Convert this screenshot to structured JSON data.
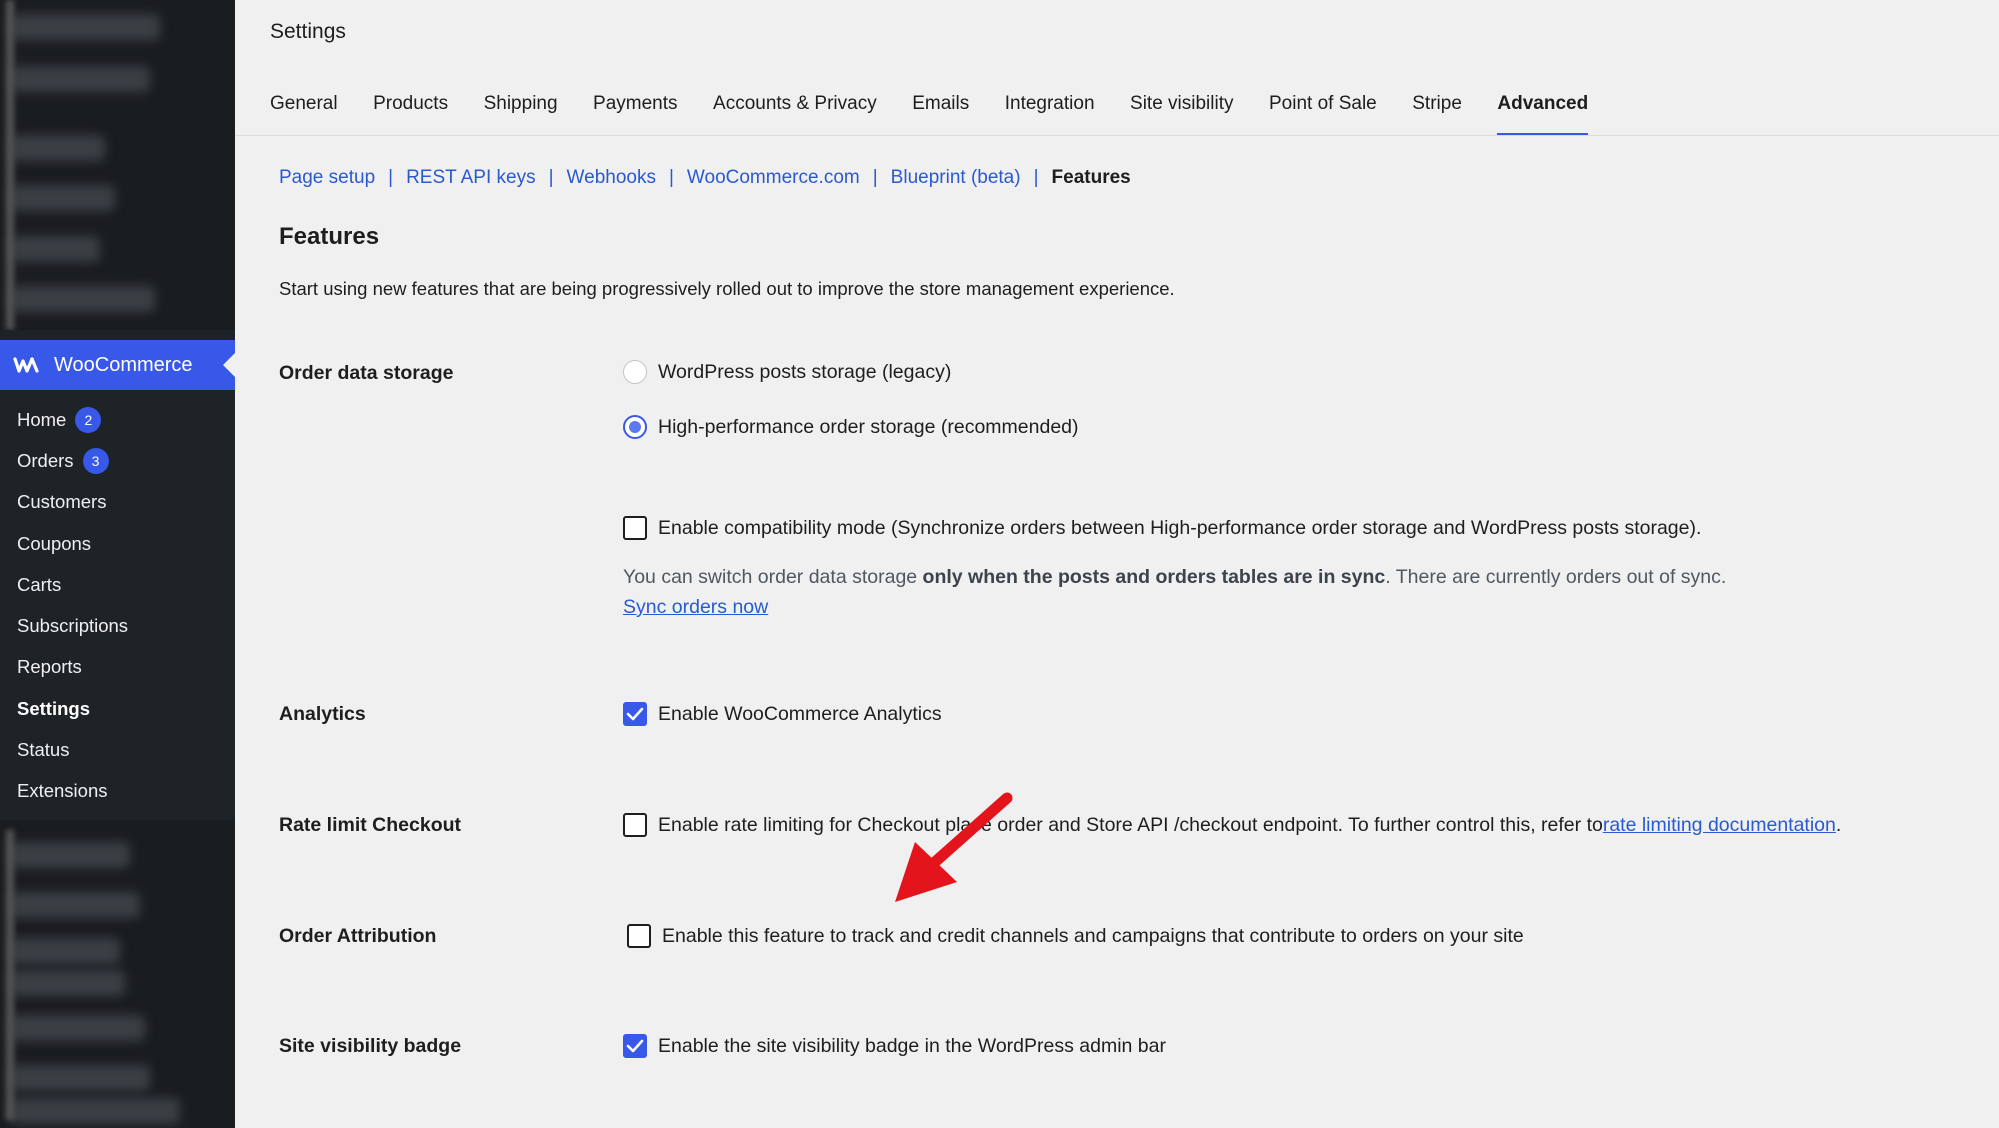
{
  "sidebar": {
    "brand_label": "WooCommerce",
    "items": [
      {
        "label": "Home",
        "badge": "2"
      },
      {
        "label": "Orders",
        "badge": "3"
      },
      {
        "label": "Customers"
      },
      {
        "label": "Coupons"
      },
      {
        "label": "Carts"
      },
      {
        "label": "Subscriptions"
      },
      {
        "label": "Reports"
      },
      {
        "label": "Settings",
        "active": true
      },
      {
        "label": "Status"
      },
      {
        "label": "Extensions"
      }
    ],
    "accent_color": "#3858e9"
  },
  "page": {
    "title": "Settings",
    "tabs": [
      "General",
      "Products",
      "Shipping",
      "Payments",
      "Accounts & Privacy",
      "Emails",
      "Integration",
      "Site visibility",
      "Point of Sale",
      "Stripe",
      "Advanced"
    ],
    "active_tab": "Advanced"
  },
  "subnav": {
    "links": [
      "Page setup",
      "REST API keys",
      "Webhooks",
      "WooCommerce.com",
      "Blueprint (beta)"
    ],
    "current": "Features"
  },
  "features": {
    "heading": "Features",
    "description": "Start using new features that are being progressively rolled out to improve the store management experience.",
    "order_storage": {
      "label": "Order data storage",
      "option_legacy": "WordPress posts storage (legacy)",
      "option_hpos": "High-performance order storage (recommended)",
      "selected": "hpos",
      "compat_label": "Enable compatibility mode (Synchronize orders between High-performance order storage and WordPress posts storage).",
      "compat_checked": false,
      "note_prefix": "You can switch order data storage ",
      "note_bold": "only when the posts and orders tables are in sync",
      "note_suffix": ". There are currently orders out of sync.",
      "sync_link": "Sync orders now"
    },
    "analytics": {
      "label": "Analytics",
      "option": "Enable WooCommerce Analytics",
      "checked": true
    },
    "rate_limit": {
      "label": "Rate limit Checkout",
      "option": "Enable rate limiting for Checkout place order and Store API /checkout endpoint. To further control this, refer to ",
      "link": "rate limiting documentation",
      "suffix": ".",
      "checked": false
    },
    "order_attribution": {
      "label": "Order Attribution",
      "option": "Enable this feature to track and credit channels and campaigns that contribute to orders on your site",
      "checked": false
    },
    "site_visibility_badge": {
      "label": "Site visibility badge",
      "option": "Enable the site visibility badge in the WordPress admin bar",
      "checked": true
    }
  }
}
